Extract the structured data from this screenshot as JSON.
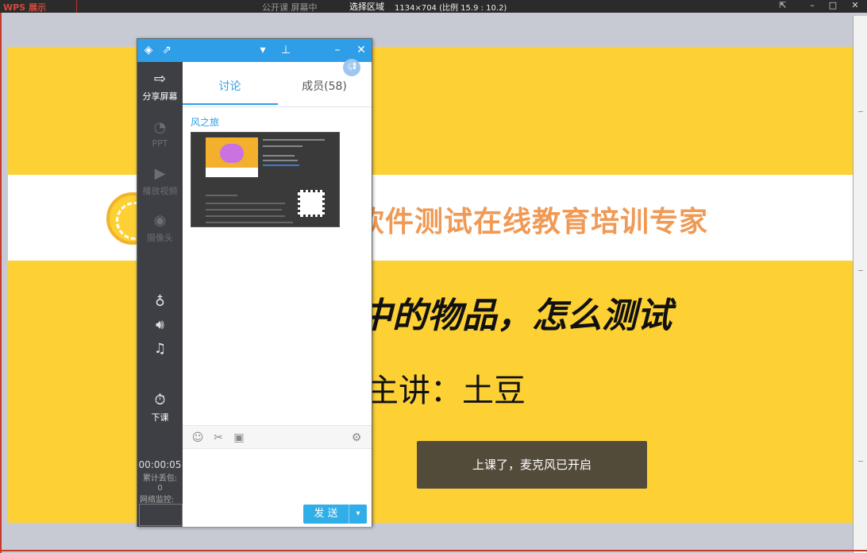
{
  "topbar": {
    "app_title": "WPS 展示",
    "middle_text": "公开课  屏幕中",
    "region_label": "选择区域",
    "region_info": "1134×704 (比例 15.9 : 10.2)"
  },
  "slide": {
    "slogan": "软件测试在线教育培训专家",
    "headline": "中的物品，怎么测试",
    "speaker": "主讲：土豆",
    "toast": "上课了，麦克风已开启"
  },
  "panel": {
    "sidebar": {
      "items": [
        {
          "label": "分享屏幕",
          "icon": "share-screen-icon"
        },
        {
          "label": "PPT",
          "icon": "ppt-icon"
        },
        {
          "label": "播放视频",
          "icon": "video-icon"
        },
        {
          "label": "摄像头",
          "icon": "camera-icon"
        }
      ],
      "class_end": "下课",
      "timer": "00:00:05",
      "loss_label": "累计丢包:",
      "loss_value": "0",
      "network_label": "网络监控:"
    },
    "tabs": {
      "discuss": "讨论",
      "members": "成员(58)"
    },
    "message": {
      "sender": "风之旅"
    },
    "send_label": "发 送",
    "colors": {
      "accent": "#2f9ee8",
      "slide_bg": "#fdd134",
      "sidebar_bg": "#3d3f44"
    }
  }
}
